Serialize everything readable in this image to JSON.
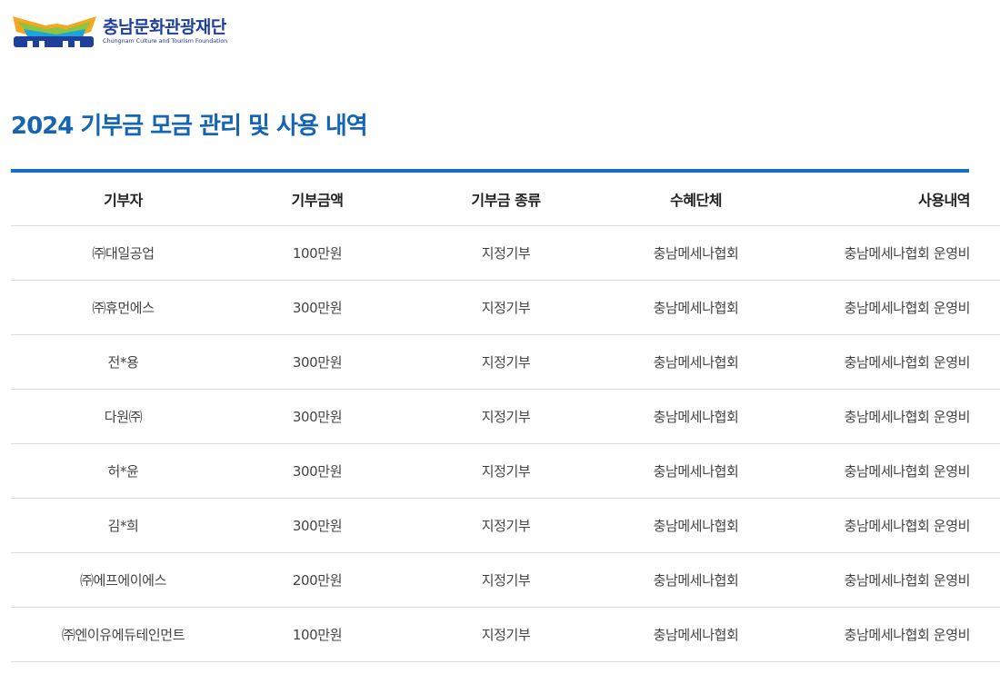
{
  "org": {
    "name_ko": "충남문화관광재단",
    "name_en": "Chungnam Culture and Tourism Foundation",
    "brand_color": "#1f3f9c"
  },
  "page": {
    "title": "2024 기부금 모금 관리 및 사용 내역"
  },
  "table": {
    "headers": [
      "기부자",
      "기부금액",
      "기부금 종류",
      "수혜단체",
      "사용내역"
    ],
    "rows": [
      [
        "㈜대일공업",
        "100만원",
        "지정기부",
        "충남메세나협회",
        "충남메세나협회 운영비"
      ],
      [
        "㈜휴먼에스",
        "300만원",
        "지정기부",
        "충남메세나협회",
        "충남메세나협회 운영비"
      ],
      [
        "전*용",
        "300만원",
        "지정기부",
        "충남메세나협회",
        "충남메세나협회 운영비"
      ],
      [
        "다원㈜",
        "300만원",
        "지정기부",
        "충남메세나협회",
        "충남메세나협회 운영비"
      ],
      [
        "허*윤",
        "300만원",
        "지정기부",
        "충남메세나협회",
        "충남메세나협회 운영비"
      ],
      [
        "김*희",
        "300만원",
        "지정기부",
        "충남메세나협회",
        "충남메세나협회 운영비"
      ],
      [
        "㈜에프에이에스",
        "200만원",
        "지정기부",
        "충남메세나협회",
        "충남메세나협회 운영비"
      ],
      [
        "㈜엔이유에듀테인먼트",
        "100만원",
        "지정기부",
        "충남메세나협회",
        "충남메세나협회 운영비"
      ]
    ]
  },
  "colors": {
    "title": "#1565b3",
    "rule": "#1570c1",
    "divider": "#dddddd"
  }
}
